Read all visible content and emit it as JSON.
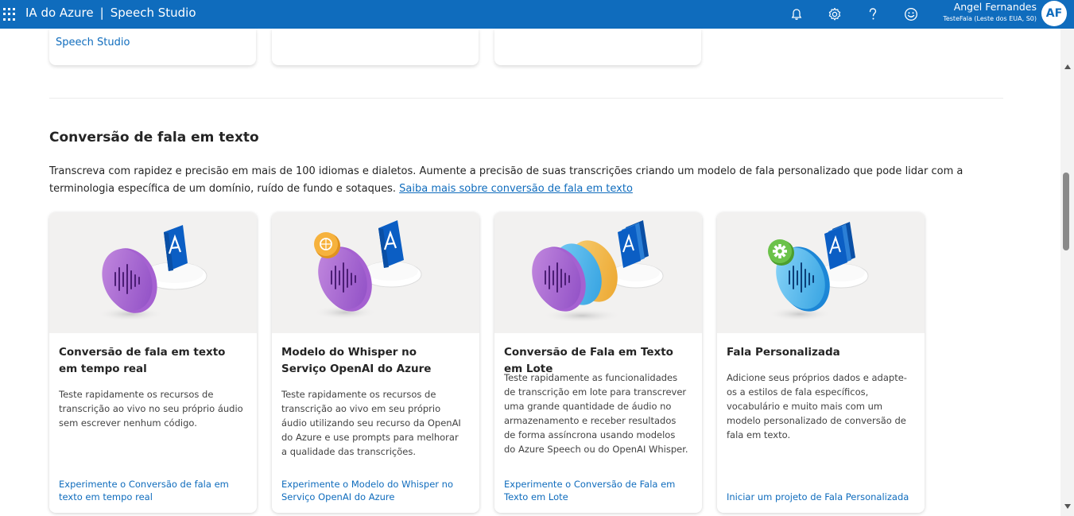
{
  "header": {
    "app_title": "IA do Azure",
    "separator": "|",
    "product": "Speech Studio",
    "user_name": "Angel Fernandes",
    "tenant": "TesteFala (Leste dos EUA, S0)",
    "avatar_initials": "AF",
    "icons": [
      "waffle-menu-icon",
      "bell-icon",
      "gear-icon",
      "help-icon",
      "smiley-icon"
    ],
    "accent": "#0f6cbd"
  },
  "previous_section": {
    "link": "Speech Studio"
  },
  "section": {
    "title": "Conversão de fala em texto",
    "description": "Transcreva com rapidez e precisão em mais de 100 idiomas e dialetos. Aumente a precisão de suas transcrições criando um modelo de fala personalizado que pode lidar com a terminologia específica de um domínio, ruído de fundo e sotaques.",
    "learn_more": "Saiba mais sobre conversão de fala em texto"
  },
  "cards": [
    {
      "title": "Conversão de fala em texto em tempo real",
      "text": "Teste rapidamente os recursos de transcrição ao vivo no seu próprio áudio sem escrever nenhum código.",
      "link": "Experimente o Conversão de fala em texto em tempo real"
    },
    {
      "title": "Modelo do Whisper no Serviço OpenAI do Azure",
      "text": "Teste rapidamente os recursos de transcrição ao vivo em seu próprio áudio utilizando seu recurso da OpenAI do Azure e use prompts para melhorar a qualidade das transcrições.",
      "link": "Experimente o Modelo do Whisper no Serviço OpenAI do Azure"
    },
    {
      "title": "Conversão de Fala em Texto em Lote",
      "text": "Teste rapidamente as funcionalidades de transcrição em lote para transcrever uma grande quantidade de áudio no armazenamento e receber resultados de forma assíncrona usando modelos do Azure Speech ou do OpenAI Whisper.",
      "link": "Experimente o Conversão de Fala em Texto em Lote"
    },
    {
      "title": "Fala Personalizada",
      "text": "Adicione seus próprios dados e adapte-os a estilos de fala específicos, vocabulário e muito mais com um modelo personalizado de conversão de fala em texto.",
      "link": "Iniciar um projeto de Fala Personalizada"
    }
  ]
}
